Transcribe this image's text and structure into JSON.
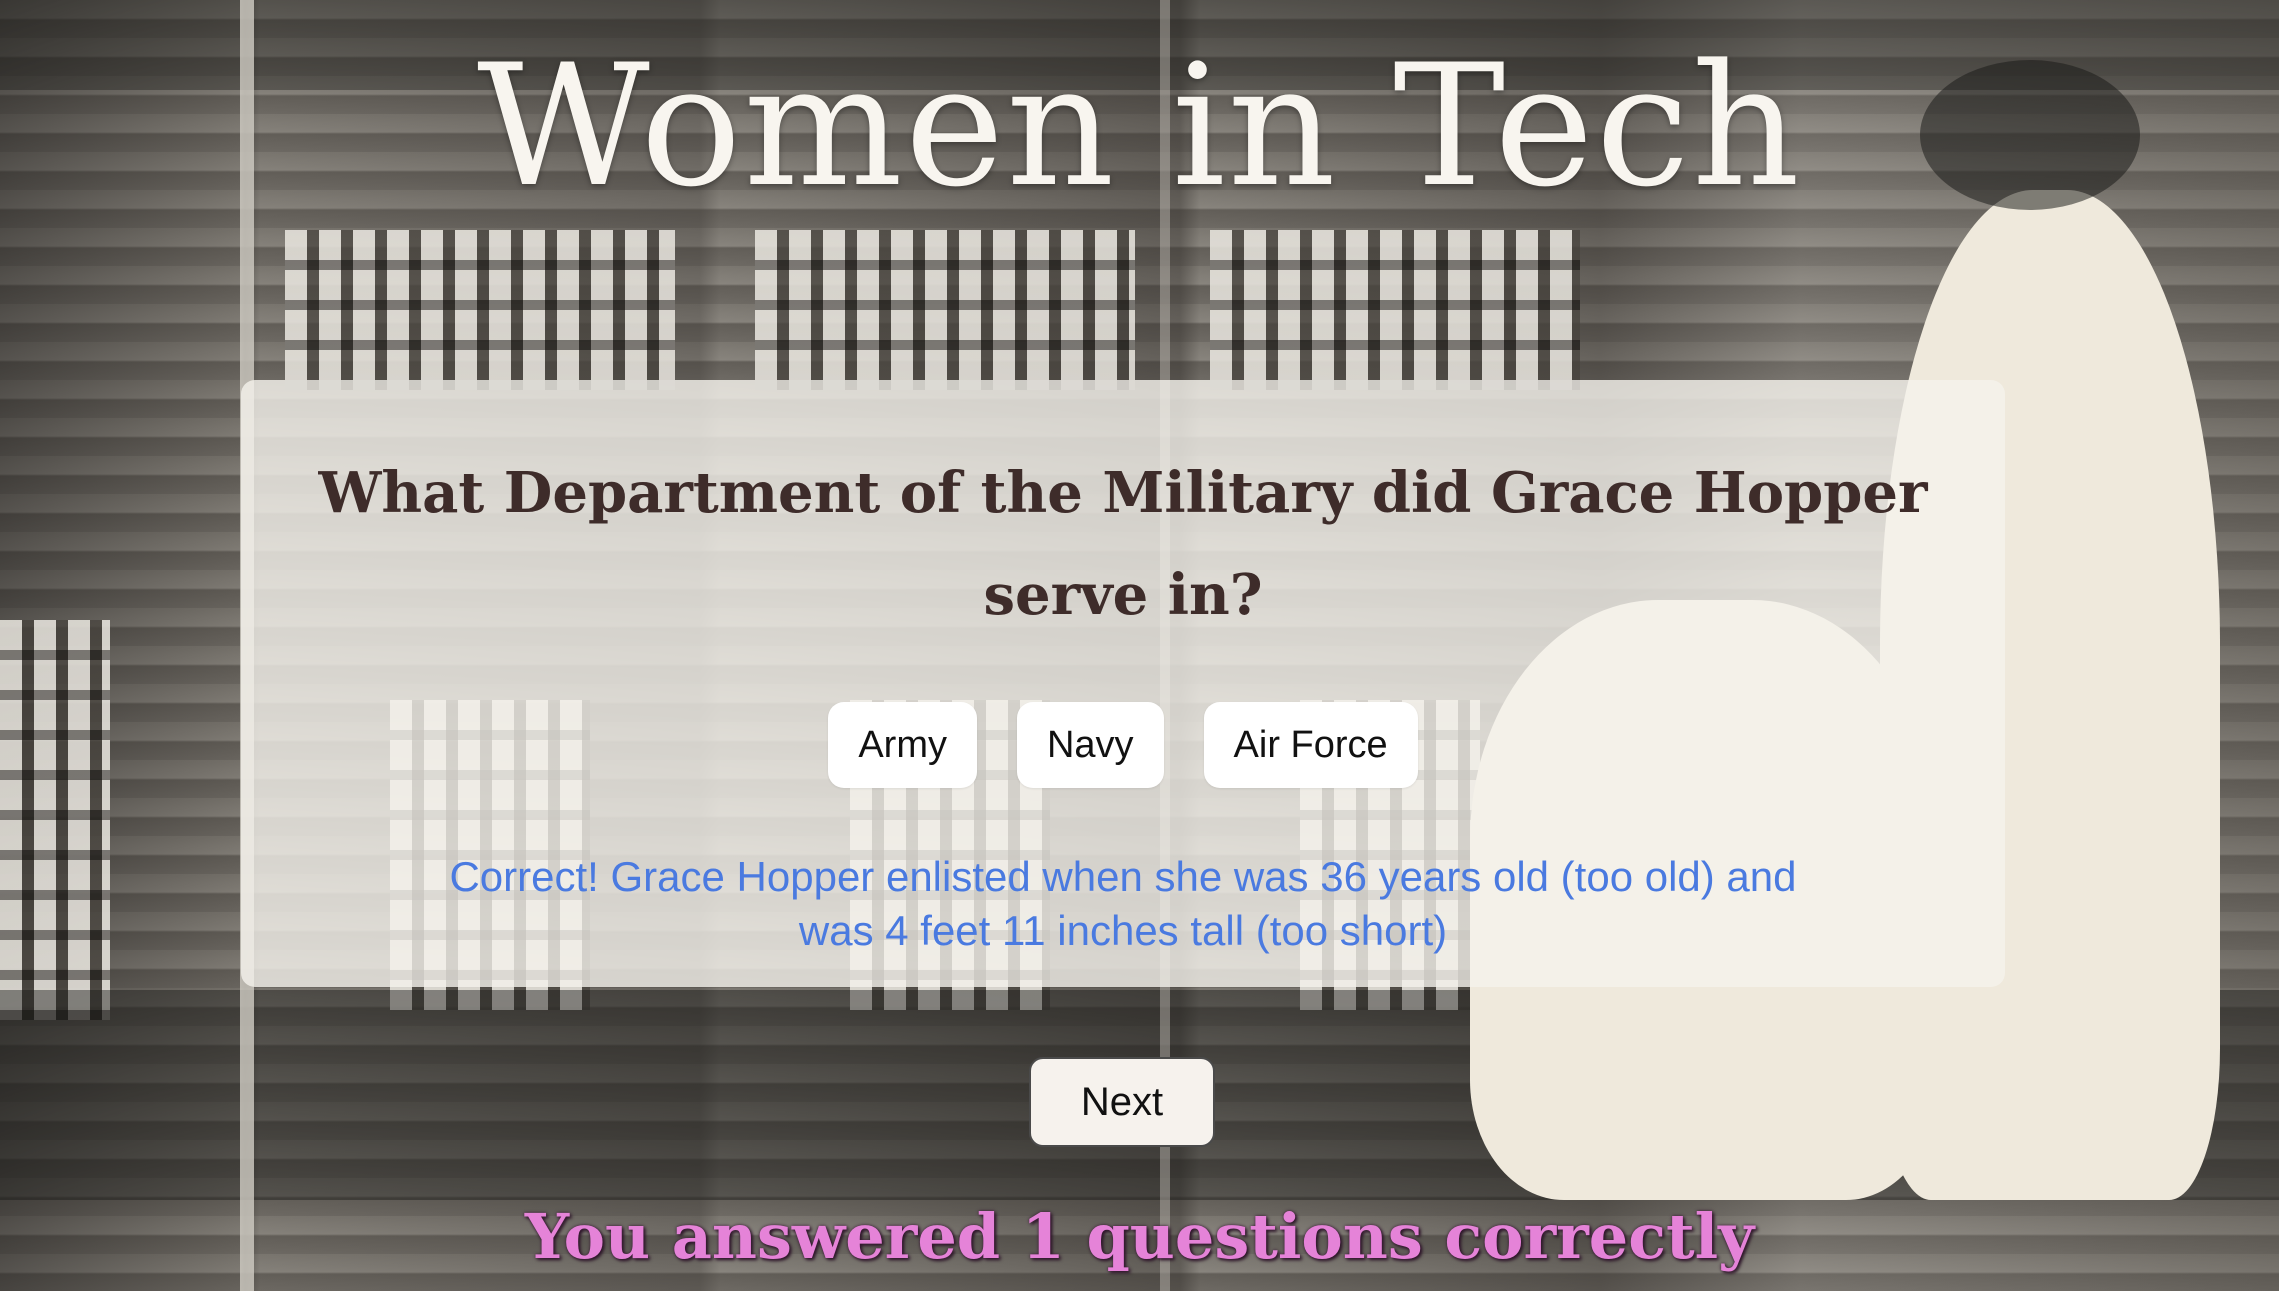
{
  "header": {
    "title": "Women in Tech"
  },
  "quiz": {
    "question": "What Department of the Military did Grace Hopper serve in?",
    "answers": [
      "Army",
      "Navy",
      "Air Force"
    ],
    "feedback": "Correct! Grace Hopper enlisted when she was 36 years old (too old) and was 4 feet 11 inches tall (too short)",
    "next_label": "Next"
  },
  "score": {
    "text": "You answered 1 questions correctly"
  },
  "colors": {
    "question_text": "#3e2c2a",
    "feedback_text": "#4a7ae0",
    "score_text": "#e583d8",
    "title_text": "#f8f5ef"
  }
}
